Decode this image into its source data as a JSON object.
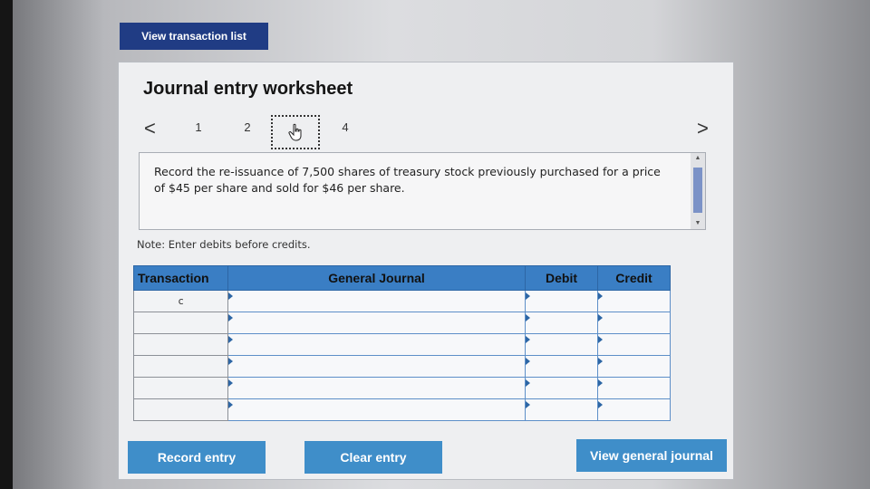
{
  "top_button": {
    "label": "View transaction list"
  },
  "worksheet": {
    "title": "Journal entry worksheet",
    "pager": {
      "prev_symbol": "<",
      "next_symbol": ">",
      "pages": [
        "1",
        "2",
        "",
        "4"
      ],
      "current_index": 2
    },
    "prompt": "Record the re-issuance of 7,500 shares of treasury stock previously purchased for a price of $45 per share and sold for $46 per share.",
    "note": "Note: Enter debits before credits.",
    "table": {
      "headers": {
        "transaction": "Transaction",
        "general_journal": "General Journal",
        "debit": "Debit",
        "credit": "Credit"
      },
      "rows": [
        {
          "transaction": "c",
          "account": "",
          "debit": "",
          "credit": ""
        },
        {
          "transaction": "",
          "account": "",
          "debit": "",
          "credit": ""
        },
        {
          "transaction": "",
          "account": "",
          "debit": "",
          "credit": ""
        },
        {
          "transaction": "",
          "account": "",
          "debit": "",
          "credit": ""
        },
        {
          "transaction": "",
          "account": "",
          "debit": "",
          "credit": ""
        },
        {
          "transaction": "",
          "account": "",
          "debit": "",
          "credit": ""
        }
      ]
    }
  },
  "actions": {
    "record_entry": "Record entry",
    "clear_entry": "Clear entry",
    "view_general_journal": "View general journal"
  },
  "icons": {
    "current_page": "hand-pointer-icon"
  },
  "colors": {
    "dark_button": "#203c84",
    "action_button": "#3f8ec9",
    "table_header": "#3a7ec4"
  }
}
